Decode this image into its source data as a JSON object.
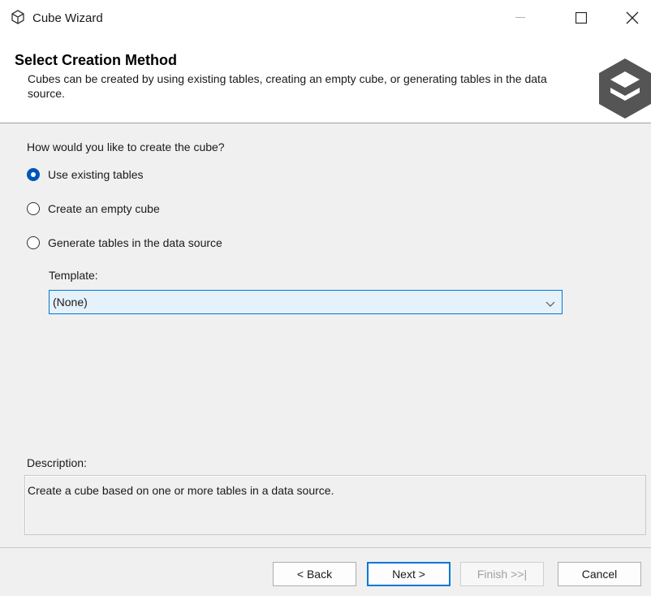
{
  "window": {
    "title": "Cube Wizard",
    "icon": "cube-icon",
    "controls": {
      "minimize": "minimize-icon",
      "maximize": "maximize-icon",
      "close": "close-icon"
    }
  },
  "header": {
    "title": "Select Creation Method",
    "subtitle": "Cubes can be created by using existing tables, creating an empty cube, or generating tables in the data source.",
    "logo": "cube-logo-icon"
  },
  "content": {
    "question": "How would you like to create the cube?",
    "options": [
      {
        "label": "Use existing tables",
        "checked": true
      },
      {
        "label": "Create an empty cube",
        "checked": false
      },
      {
        "label": "Generate tables in the data source",
        "checked": false
      }
    ],
    "template_label": "Template:",
    "template_value": "(None)",
    "description_label": "Description:",
    "description_text": "Create a cube based on one or more tables in a data source."
  },
  "buttons": {
    "back": "< Back",
    "next": "Next >",
    "finish": "Finish >>|",
    "cancel": "Cancel"
  },
  "colors": {
    "accent": "#0078d4",
    "radio_checked": "#0055b8",
    "select_bg": "#e5f1fb"
  }
}
